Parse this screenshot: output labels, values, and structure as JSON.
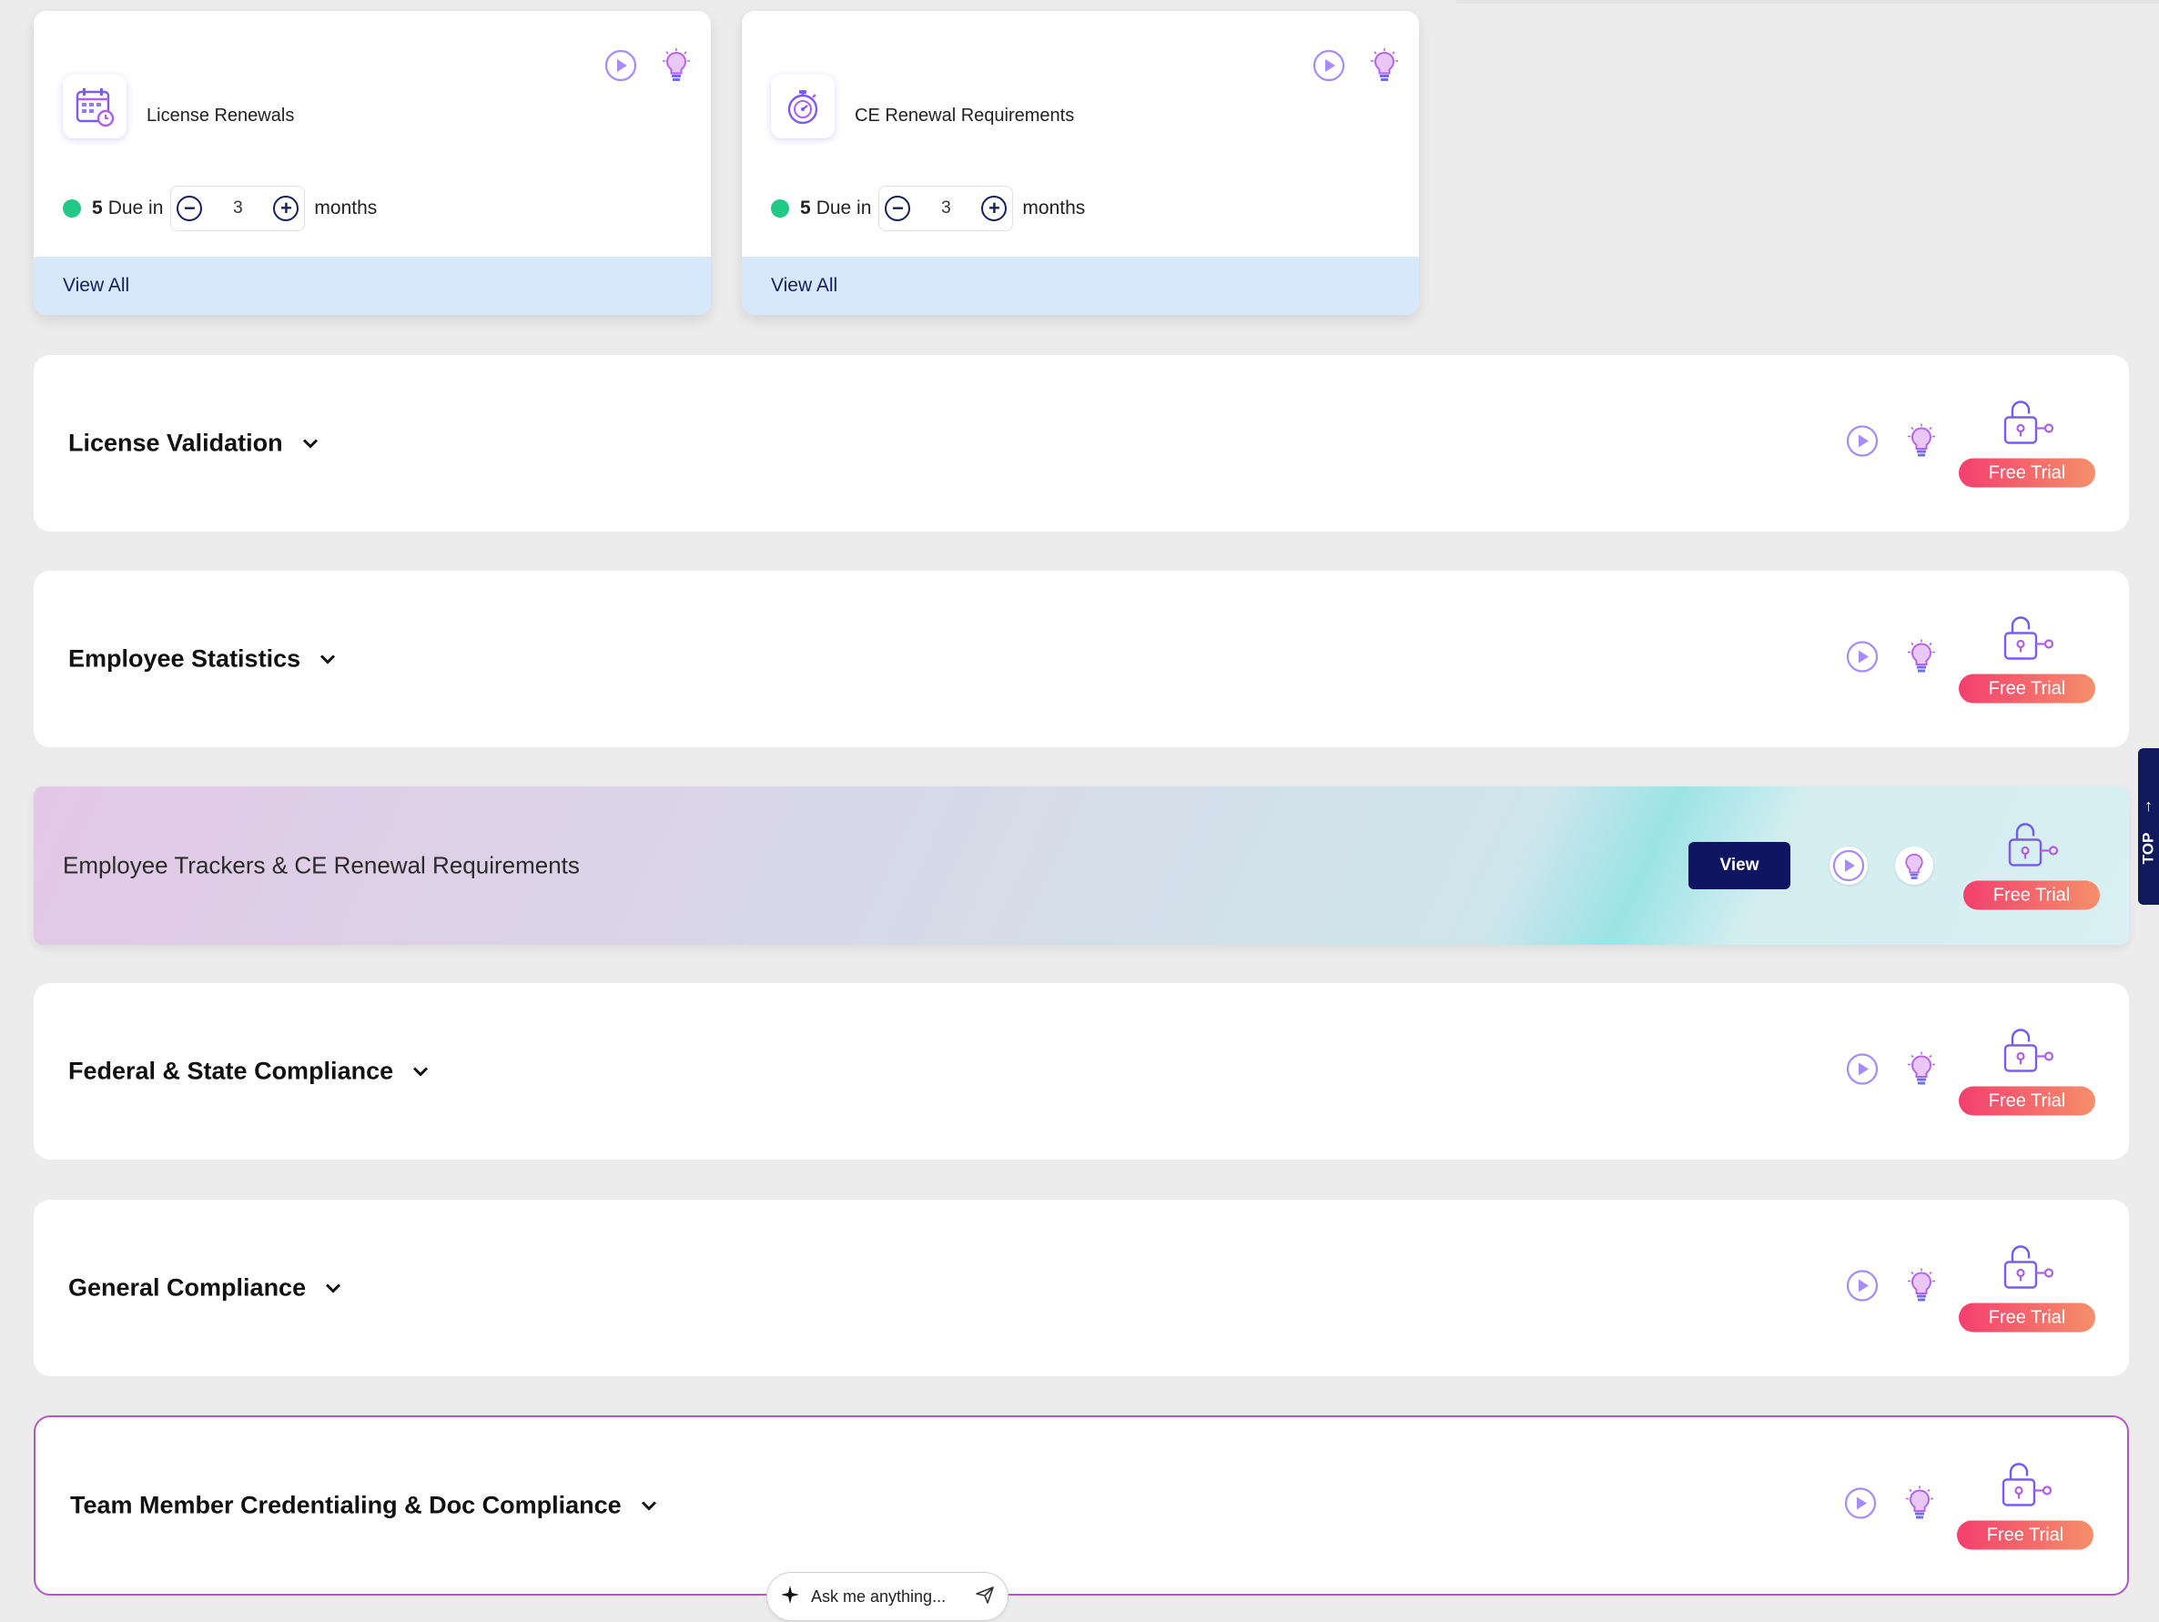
{
  "summary_cards": [
    {
      "title": "License Renewals",
      "due_count": "5",
      "due_label": "Due in",
      "stepper_value": "3",
      "unit": "months",
      "view_all": "View All",
      "icon": "calendar-icon"
    },
    {
      "title": "CE Renewal Requirements",
      "due_count": "5",
      "due_label": "Due in",
      "stepper_value": "3",
      "unit": "months",
      "view_all": "View All",
      "icon": "stopwatch-icon"
    }
  ],
  "sections": [
    {
      "title": "License Validation",
      "free_trial": "Free Trial"
    },
    {
      "title": "Employee Statistics",
      "free_trial": "Free Trial"
    },
    {
      "title": "Employee Trackers & CE Renewal Requirements",
      "view_label": "View",
      "free_trial": "Free Trial",
      "highlighted": true
    },
    {
      "title": "Federal & State Compliance",
      "free_trial": "Free Trial"
    },
    {
      "title": "General Compliance",
      "free_trial": "Free Trial"
    },
    {
      "title": "Team Member Credentialing & Doc Compliance",
      "free_trial": "Free Trial",
      "outlined": true
    }
  ],
  "top_tab": {
    "label": "TOP",
    "arrow": "↑"
  },
  "ask": {
    "placeholder": "Ask me anything..."
  },
  "colors": {
    "accent_navy": "#0f1561",
    "status_green": "#22c986",
    "trial_start": "#f43f6e",
    "trial_end": "#f58f6a",
    "icon_purple": "#8b5cf6"
  },
  "icons": [
    "play-icon",
    "lightbulb-icon",
    "lock-key-icon",
    "chevron-down-icon",
    "sparkle-icon",
    "send-icon"
  ]
}
